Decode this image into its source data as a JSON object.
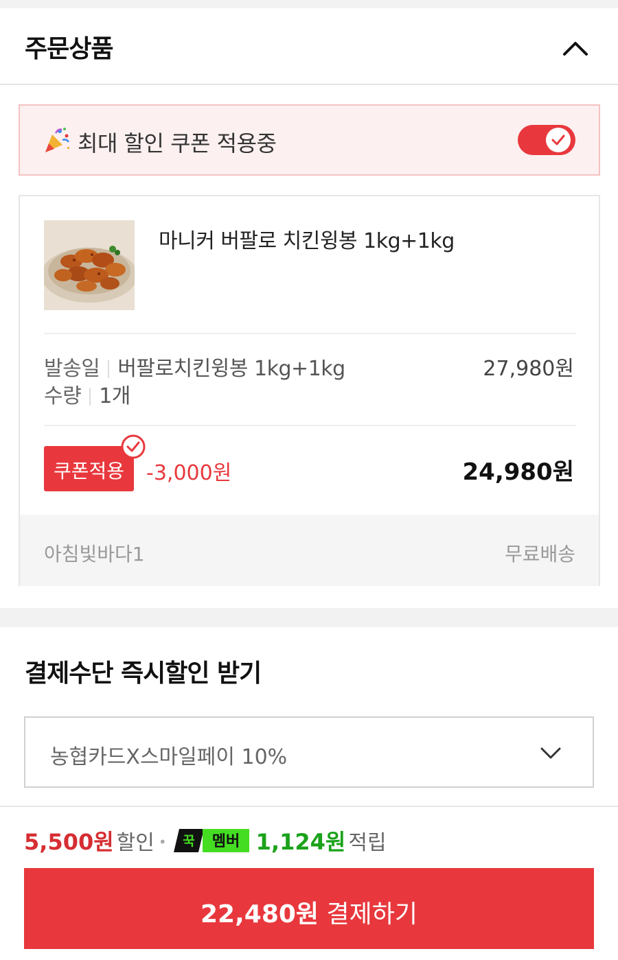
{
  "order_section": {
    "title": "주문상품",
    "coupon_banner": {
      "text": "최대 할인 쿠폰 적용중",
      "toggle_on": true,
      "icon": "party-popper-icon"
    },
    "product": {
      "name": "마니커 버팔로 치킨윙봉 1kg+1kg",
      "option_label": "발송일",
      "option_value": "버팔로치킨윙봉 1kg+1kg",
      "option_price": "27,980원",
      "qty_label": "수량",
      "qty_value": "1개",
      "coupon_tag": "쿠폰적용",
      "coupon_discount": "-3,000원",
      "final_price": "24,980원",
      "seller": "아침빛바다1",
      "shipping": "무료배송"
    }
  },
  "payment_section": {
    "title": "결제수단 즉시할인 받기",
    "selected_method": "농협카드X스마일페이 10%"
  },
  "bottom_bar": {
    "discount_amount": "5,500원",
    "discount_suffix": "할인",
    "member_badge_text": "멤버",
    "points_amount": "1,124원",
    "points_suffix": "적립",
    "pay_amount": "22,480원",
    "pay_label": "결제하기"
  },
  "colors": {
    "accent_red": "#e8383d",
    "banner_bg": "#fdf0f0",
    "points_green": "#1ba21b",
    "badge_green": "#44dd22"
  }
}
